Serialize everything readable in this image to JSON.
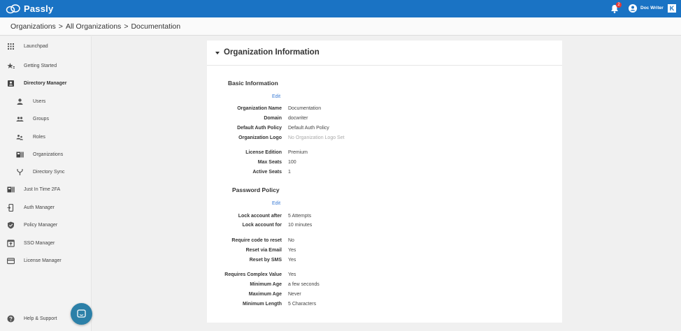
{
  "header": {
    "app_name": "Passly",
    "notification_count": "2",
    "user_name": "Doc Writer",
    "brand_glyph": "K",
    "accent_color": "#1a73c4"
  },
  "breadcrumb": {
    "items": [
      "Organizations",
      "All Organizations",
      "Documentation"
    ],
    "separator": ">"
  },
  "sidebar": {
    "items": [
      {
        "label": "Launchpad",
        "icon": "grid-icon"
      },
      {
        "label": "Getting Started",
        "icon": "star-icon"
      },
      {
        "label": "Directory Manager",
        "icon": "contact-card-icon"
      },
      {
        "label": "Users",
        "icon": "person-icon"
      },
      {
        "label": "Groups",
        "icon": "people-icon"
      },
      {
        "label": "Roles",
        "icon": "roles-icon"
      },
      {
        "label": "Organizations",
        "icon": "org-icon"
      },
      {
        "label": "Directory Sync",
        "icon": "fork-icon"
      },
      {
        "label": "Just In Time 2FA",
        "icon": "jit-icon"
      },
      {
        "label": "Auth Manager",
        "icon": "device-icon"
      },
      {
        "label": "Policy Manager",
        "icon": "shield-icon"
      },
      {
        "label": "SSO Manager",
        "icon": "sso-icon"
      },
      {
        "label": "License Manager",
        "icon": "card-icon"
      },
      {
        "label": "Help & Support",
        "icon": "help-icon"
      }
    ]
  },
  "card": {
    "title": "Organization Information",
    "basic": {
      "title": "Basic Information",
      "edit_label": "Edit",
      "rows": [
        {
          "key": "Organization Name",
          "value": "Documentation"
        },
        {
          "key": "Domain",
          "value": "docwriter"
        },
        {
          "key": "Default Auth Policy",
          "value": "Default Auth Policy"
        },
        {
          "key": "Organization Logo",
          "value": "No Organization Logo Set"
        },
        {
          "key": "License Edition",
          "value": "Premium"
        },
        {
          "key": "Max Seats",
          "value": "100"
        },
        {
          "key": "Active Seats",
          "value": "1"
        }
      ]
    },
    "password": {
      "title": "Password Policy",
      "edit_label": "Edit",
      "rows": [
        {
          "key": "Lock account after",
          "value": "5 Attempts"
        },
        {
          "key": "Lock account for",
          "value": "10 minutes"
        },
        {
          "key": "Require code to reset",
          "value": "No"
        },
        {
          "key": "Reset via Email",
          "value": "Yes"
        },
        {
          "key": "Reset by SMS",
          "value": "Yes"
        },
        {
          "key": "Requires Complex Value",
          "value": "Yes"
        },
        {
          "key": "Minimum Age",
          "value": "a few seconds"
        },
        {
          "key": "Maximum Age",
          "value": "Never"
        },
        {
          "key": "Minimum Length",
          "value": "5 Characters"
        }
      ]
    }
  }
}
